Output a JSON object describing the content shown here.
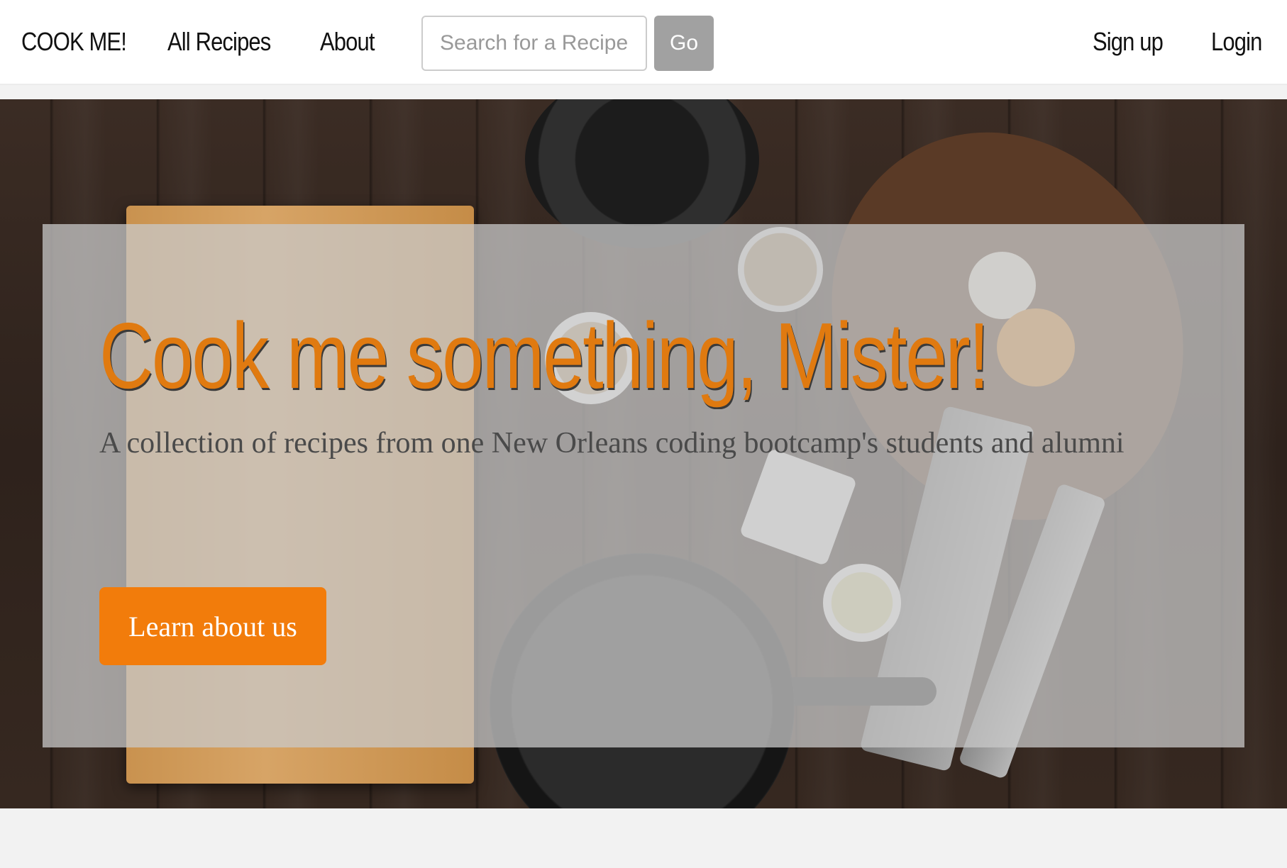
{
  "navbar": {
    "brand": "COOK ME!",
    "links": {
      "all_recipes": "All Recipes",
      "about": "About",
      "sign_up": "Sign up",
      "login": "Login"
    },
    "search": {
      "placeholder": "Search for a Recipe",
      "value": "",
      "button_label": "Go"
    }
  },
  "hero": {
    "title": "Cook me something, Mister!",
    "subtitle": "A collection of recipes from one New Orleans coding bootcamp's students and alumni",
    "cta_label": "Learn about us"
  },
  "colors": {
    "accent": "#f27c0b",
    "title": "#e07a10",
    "go_button": "#a1a1a1",
    "panel": "rgba(200,200,200,0.75)"
  }
}
